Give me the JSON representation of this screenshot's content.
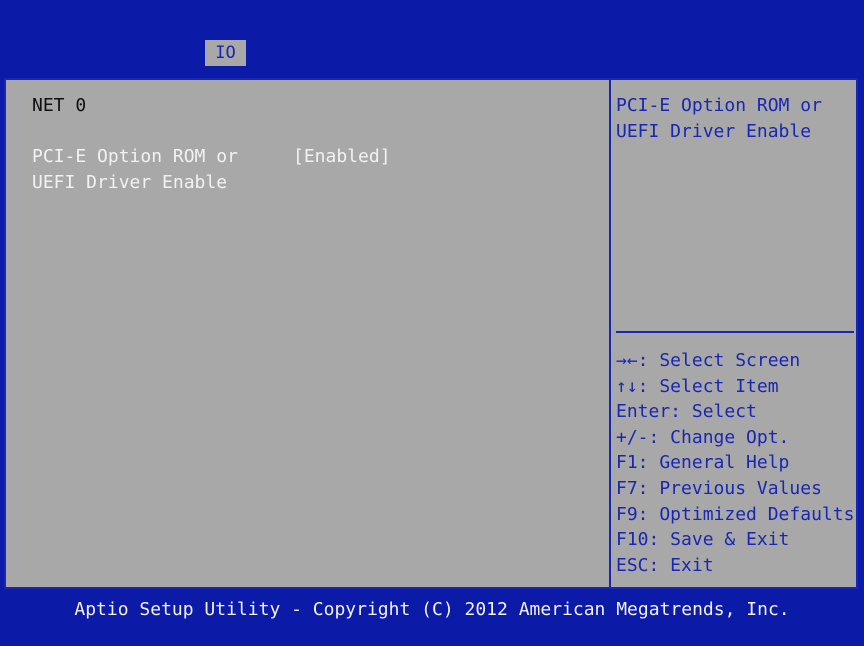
{
  "tabs": {
    "active": "IO"
  },
  "page": {
    "section_title": "NET 0"
  },
  "option": {
    "label": "PCI-E Option ROM or\nUEFI Driver Enable",
    "value": "[Enabled]"
  },
  "help": {
    "text": "PCI-E Option ROM or\nUEFI Driver Enable"
  },
  "keys": [
    "→←: Select Screen",
    "↑↓: Select Item",
    "Enter: Select",
    "+/-: Change Opt.",
    "F1: General Help",
    "F7: Previous Values",
    "F9: Optimized Defaults",
    "F10: Save & Exit",
    "ESC: Exit"
  ],
  "footer": {
    "text": "Aptio Setup Utility - Copyright (C) 2012 American Megatrends, Inc."
  },
  "colors": {
    "background": "#0c1aa8",
    "panel": "#a8a8a8",
    "accent": "#1826b4",
    "highlight_text": "#f2f2f2"
  }
}
